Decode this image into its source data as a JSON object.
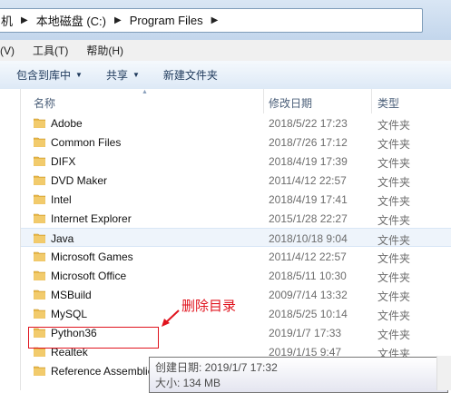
{
  "address": {
    "items": [
      "机",
      "本地磁盘 (C:)",
      "Program Files"
    ]
  },
  "menu": [
    "(V)",
    "工具(T)",
    "帮助(H)"
  ],
  "toolbar": {
    "include": "包含到库中",
    "share": "共享",
    "new_folder": "新建文件夹"
  },
  "columns": {
    "name": "名称",
    "date": "修改日期",
    "type": "类型"
  },
  "files": [
    {
      "name": "Adobe",
      "date": "2018/5/22 17:23",
      "type": "文件夹"
    },
    {
      "name": "Common Files",
      "date": "2018/7/26 17:12",
      "type": "文件夹"
    },
    {
      "name": "DIFX",
      "date": "2018/4/19 17:39",
      "type": "文件夹"
    },
    {
      "name": "DVD Maker",
      "date": "2011/4/12 22:57",
      "type": "文件夹"
    },
    {
      "name": "Intel",
      "date": "2018/4/19 17:41",
      "type": "文件夹"
    },
    {
      "name": "Internet Explorer",
      "date": "2015/1/28 22:27",
      "type": "文件夹"
    },
    {
      "name": "Java",
      "date": "2018/10/18 9:04",
      "type": "文件夹"
    },
    {
      "name": "Microsoft Games",
      "date": "2011/4/12 22:57",
      "type": "文件夹"
    },
    {
      "name": "Microsoft Office",
      "date": "2018/5/11 10:30",
      "type": "文件夹"
    },
    {
      "name": "MSBuild",
      "date": "2009/7/14 13:32",
      "type": "文件夹"
    },
    {
      "name": "MySQL",
      "date": "2018/5/25 10:14",
      "type": "文件夹"
    },
    {
      "name": "Python36",
      "date": "2019/1/7 17:33",
      "type": "文件夹"
    },
    {
      "name": "Realtek",
      "date": "2019/1/15 9:47",
      "type": "文件夹"
    },
    {
      "name": "Reference Assemblies",
      "date": "",
      "type": ""
    }
  ],
  "annotation": "删除目录",
  "tooltip": {
    "created": "创建日期: 2019/1/7 17:32",
    "size": "大小: 134 MB"
  },
  "colors": {
    "folder": "#e8b84a",
    "annotation": "#e0141e"
  }
}
